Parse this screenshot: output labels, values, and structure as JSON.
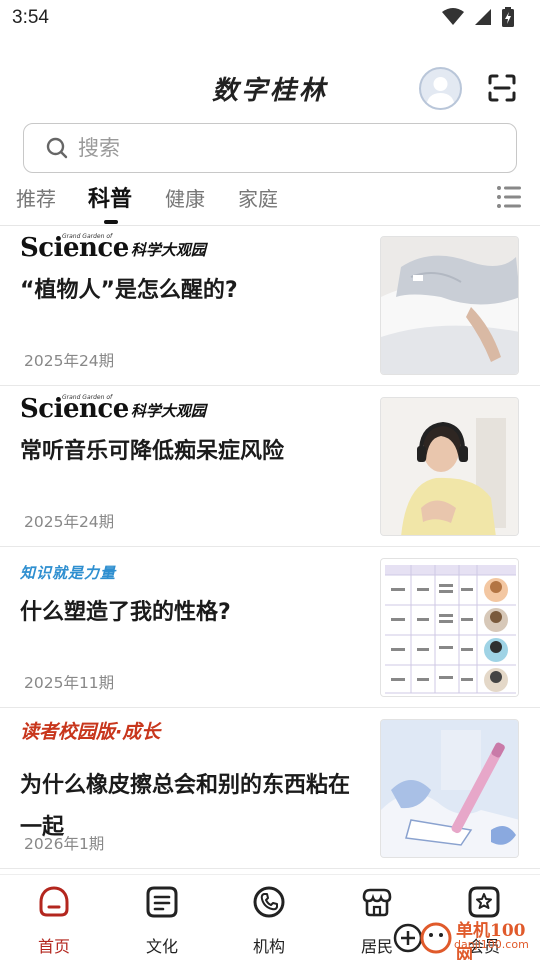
{
  "status_bar": {
    "time": "3:54"
  },
  "header": {
    "title": "数字桂林"
  },
  "search": {
    "placeholder": "搜索"
  },
  "tabs": [
    {
      "label": "推荐",
      "active": false
    },
    {
      "label": "科普",
      "active": true
    },
    {
      "label": "健康",
      "active": false
    },
    {
      "label": "家庭",
      "active": false
    }
  ],
  "articles": [
    {
      "source_main": "Science",
      "source_sub": "科学大观园",
      "source_mini": "Grand Garden of",
      "title": "“植物人”是怎么醒的?",
      "issue": "2025年24期",
      "thumb_icon": "hospital-patient-image"
    },
    {
      "source_main": "Science",
      "source_sub": "科学大观园",
      "source_mini": "Grand Garden of",
      "title": "常听音乐可降低痴呆症风险",
      "issue": "2025年24期",
      "thumb_icon": "headphones-woman-image"
    },
    {
      "source_main": "知识就是力量",
      "title": "什么塑造了我的性格?",
      "issue": "2025年11期",
      "thumb_icon": "personality-table-image"
    },
    {
      "source_main": "读者校园版·成长",
      "title": "为什么橡皮擦总会和别的东西粘在一起",
      "issue": "2026年1期",
      "thumb_icon": "eraser-pen-illustration"
    }
  ],
  "bottom_nav": [
    {
      "label": "首页",
      "icon": "home-icon",
      "active": true
    },
    {
      "label": "文化",
      "icon": "document-icon",
      "active": false
    },
    {
      "label": "机构",
      "icon": "phone-icon",
      "active": false
    },
    {
      "label": "居民",
      "icon": "store-icon",
      "active": false
    },
    {
      "label": "会员",
      "icon": "star-badge-icon",
      "active": false
    }
  ],
  "watermark": {
    "text_top": "单机100网",
    "text_bottom": "danji100.com"
  },
  "colors": {
    "accent": "#b3261e",
    "reader_source": "#c8361c",
    "knowledge_source": "#2f8fd0"
  }
}
